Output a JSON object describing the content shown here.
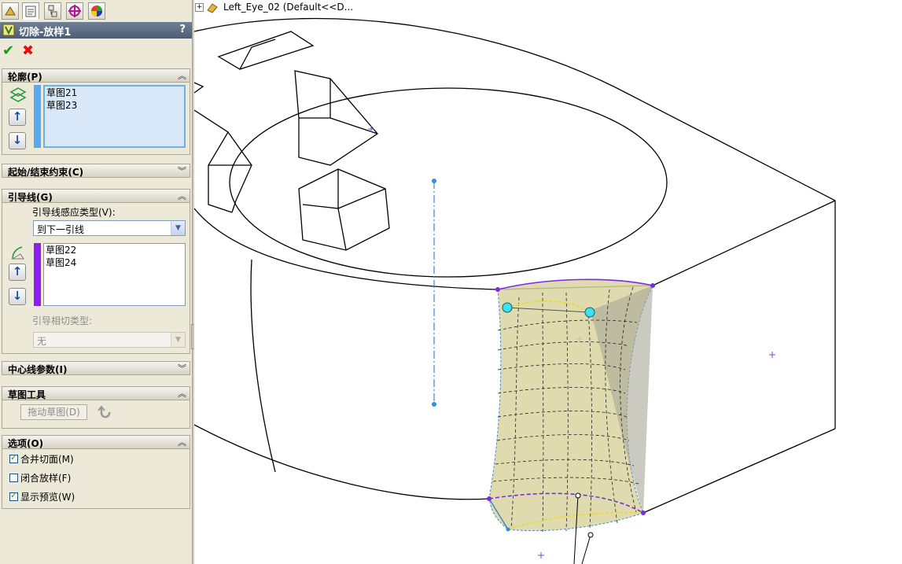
{
  "feature_tree": {
    "part_name": "Left_Eye_02",
    "config": "(Default<<D..."
  },
  "panel": {
    "title": "切除-放样1",
    "help": "?",
    "profiles": {
      "header": "轮廓(P)",
      "items": [
        "草图21",
        "草图23"
      ]
    },
    "start_end": {
      "header": "起始/结束约束(C)"
    },
    "guides": {
      "header": "引导线(G)",
      "influence_label": "引导线感应类型(V):",
      "influence_value": "到下一引线",
      "items": [
        "草图22",
        "草图24"
      ],
      "tangency_label": "引导相切类型:",
      "tangency_value": "无"
    },
    "centerline": {
      "header": "中心线参数(I)"
    },
    "sketch_tools": {
      "header": "草图工具",
      "drag_button": "拖动草图(D)"
    },
    "options": {
      "header": "选项(O)",
      "merge": {
        "label": "合并切面(M)",
        "checked": true
      },
      "close": {
        "label": "闭合放样(F)",
        "checked": false
      },
      "preview": {
        "label": "显示预览(W)",
        "checked": true
      }
    }
  },
  "colors": {
    "profile_bar": "#5aa8f0",
    "guide_bar": "#8b1ff0",
    "preview_fill": "#d9d5a0"
  }
}
